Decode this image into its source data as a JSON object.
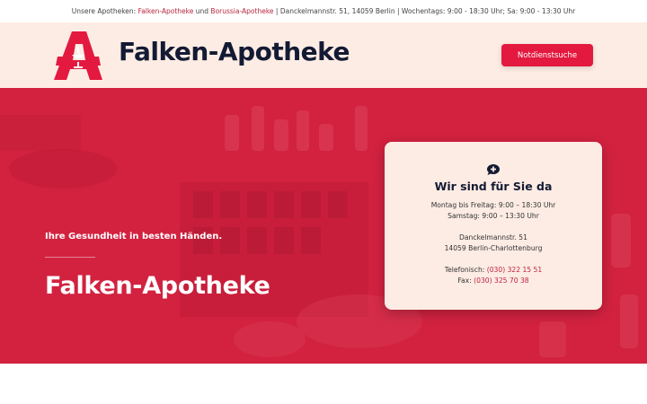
{
  "topbar": {
    "prefix": "Unsere Apotheken:",
    "link1": "Falken-Apotheke",
    "conj": "und",
    "link2": "Borussia-Apotheke",
    "rest": "| Danckelmannstr. 51, 14059 Berlin | Wochentags: 9:00 - 18:30 Uhr; Sa: 9:00 - 13:30 Uhr"
  },
  "header": {
    "title": "Falken-Apotheke",
    "button": "Notdienstsuche",
    "logo_icon": "apotheke-a-logo-icon",
    "brand_color": "#e3193f"
  },
  "hero": {
    "tagline": "Ihre Gesundheit in besten Händen.",
    "title": "Falken-Apotheke",
    "overlay_color": "#d22240"
  },
  "card": {
    "icon": "chat-plus-icon",
    "title": "Wir sind für Sie da",
    "hours_weekday": "Montag bis Freitag: 9:00 – 18:30 Uhr",
    "hours_saturday": "Samstag: 9:00 – 13:30 Uhr",
    "street": "Danckelmannstr. 51",
    "city": "14059 Berlin-Charlottenburg",
    "phone_label": "Telefonisch:",
    "phone": "(030) 322 15 51",
    "fax_label": "Fax:",
    "fax": "(030) 325 70 38"
  }
}
